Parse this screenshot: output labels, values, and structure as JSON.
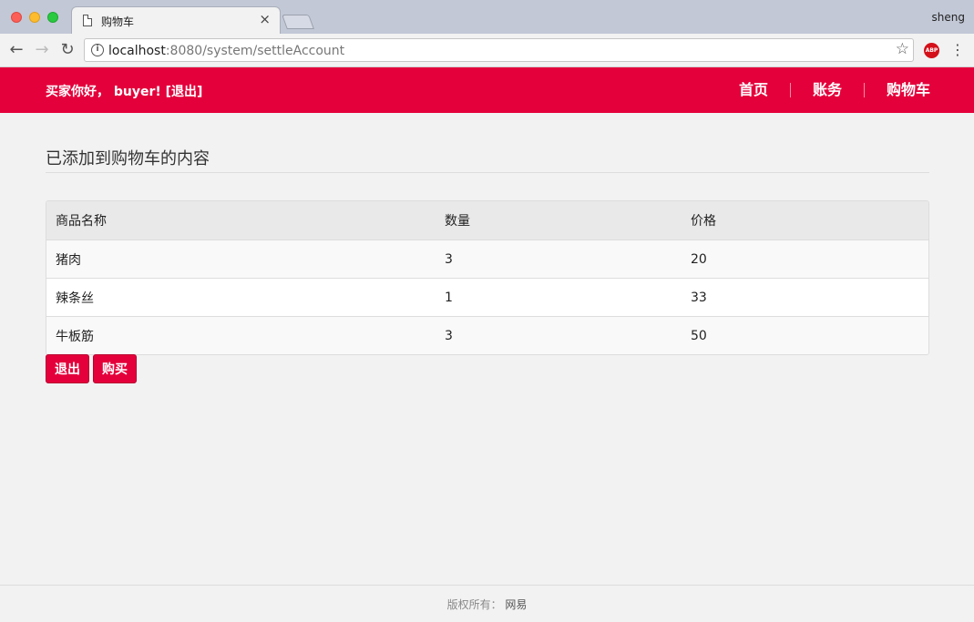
{
  "browser": {
    "tab_title": "购物车",
    "profile_name": "sheng",
    "url_host": "localhost",
    "url_rest": ":8080/system/settleAccount",
    "abp_label": "ABP"
  },
  "header": {
    "greeting": "买家你好， buyer!  [退出]",
    "nav": [
      {
        "label": "首页"
      },
      {
        "label": "账务"
      },
      {
        "label": "购物车"
      }
    ],
    "color": "#e4003b"
  },
  "main": {
    "title": "已添加到购物车的内容",
    "table": {
      "headers": [
        "商品名称",
        "数量",
        "价格"
      ],
      "rows": [
        {
          "name": "猪肉",
          "qty": "3",
          "price": "20"
        },
        {
          "name": "辣条丝",
          "qty": "1",
          "price": "33"
        },
        {
          "name": "牛板筋",
          "qty": "3",
          "price": "50"
        }
      ]
    },
    "buttons": {
      "logout": "退出",
      "buy": "购买"
    }
  },
  "footer": {
    "label": "版权所有：",
    "owner": "网易"
  }
}
